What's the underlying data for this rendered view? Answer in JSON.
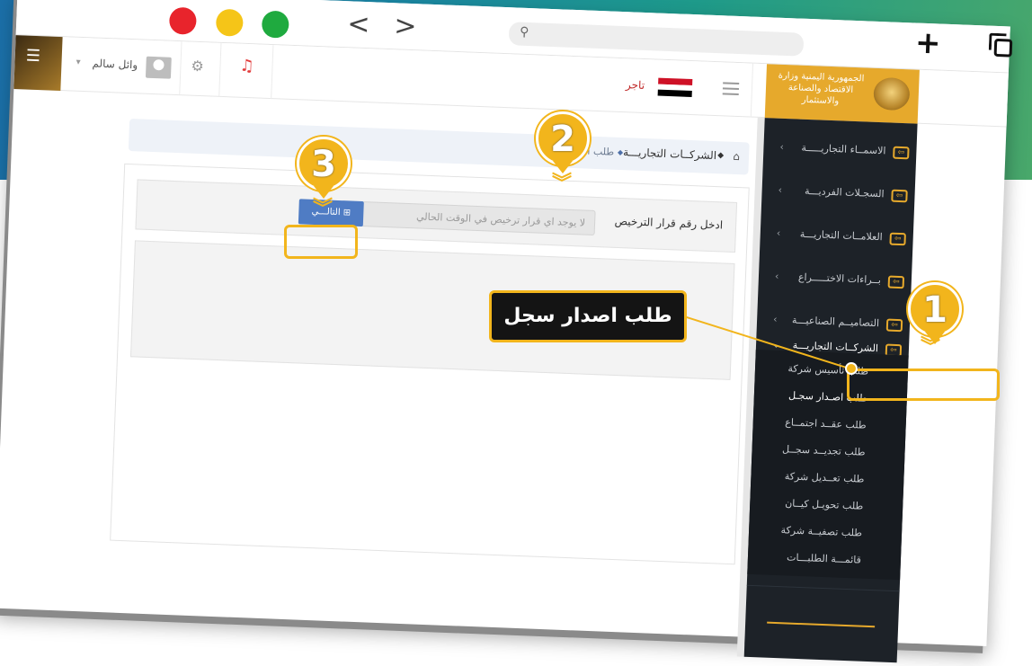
{
  "browser": {
    "back_glyph": "<",
    "forward_glyph": ">",
    "new_tab_glyph": "+",
    "search_icon": "magnifier-icon"
  },
  "header": {
    "user_name": "وائل سالم",
    "user_caret": "▾",
    "trader_label": "تاجر",
    "brand_text": "الجمهورية اليمنية وزارة الاقتصاد والصناعة والاستثمار",
    "flag_colors": [
      "#ce1126",
      "#ffffff",
      "#000000"
    ],
    "accent_color": "#e6a92c"
  },
  "sidebar": {
    "items": [
      {
        "label": "الاسمــاء التجاريـــــة",
        "chevron": "‹"
      },
      {
        "label": "السجـلات الفرديـــة",
        "chevron": "‹"
      },
      {
        "label": "العلامــات التجاريـــة",
        "chevron": "‹"
      },
      {
        "label": "بــراءات الاختـــــراع",
        "chevron": "‹"
      },
      {
        "label": "التصاميــم الصناعيـــة",
        "chevron": "‹"
      },
      {
        "label": "الشركــات التجاريـــة",
        "chevron": "⌄"
      }
    ],
    "subitems": [
      "طلب تأسيس شركة",
      "طلب اصـدار سجـل",
      "طلب عقــد اجتمــاع",
      "طلب تجديــد سجــل",
      "طلب تعــديل شركة",
      "طلب تحويـل كيــان",
      "طلب تصفيــة شركة",
      "قائمـــة الطلبـــات"
    ]
  },
  "breadcrumb": {
    "home_icon": "⌂",
    "level1": "الشركــات التجاريـــة",
    "level2": "طلب اصــدار سـ",
    "sep": "◆"
  },
  "form": {
    "label": "ادخل رقم قرار الترخيص",
    "input_value": "لا يوجد اي قرار ترخيص في الوقت الحالي",
    "next_label": "التالـــي ⊞"
  },
  "annotations": {
    "pin1": "1",
    "pin2": "2",
    "pin3": "3",
    "chevron_glyph": "︾",
    "callout": "طلب اصدار سجل",
    "highlight_color": "#f2b51c"
  }
}
